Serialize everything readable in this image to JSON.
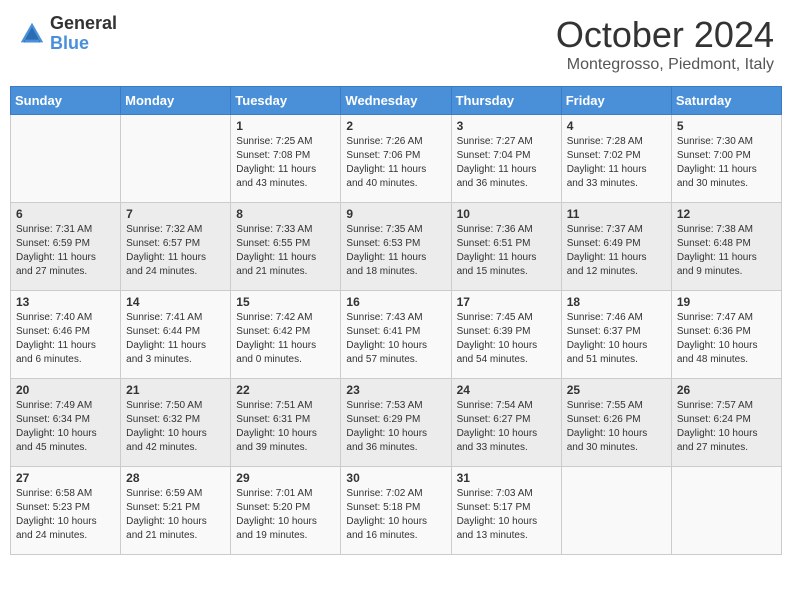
{
  "logo": {
    "general": "General",
    "blue": "Blue"
  },
  "title": "October 2024",
  "location": "Montegrosso, Piedmont, Italy",
  "days_of_week": [
    "Sunday",
    "Monday",
    "Tuesday",
    "Wednesday",
    "Thursday",
    "Friday",
    "Saturday"
  ],
  "weeks": [
    [
      {
        "day": "",
        "info": ""
      },
      {
        "day": "",
        "info": ""
      },
      {
        "day": "1",
        "info": "Sunrise: 7:25 AM\nSunset: 7:08 PM\nDaylight: 11 hours and 43 minutes."
      },
      {
        "day": "2",
        "info": "Sunrise: 7:26 AM\nSunset: 7:06 PM\nDaylight: 11 hours and 40 minutes."
      },
      {
        "day": "3",
        "info": "Sunrise: 7:27 AM\nSunset: 7:04 PM\nDaylight: 11 hours and 36 minutes."
      },
      {
        "day": "4",
        "info": "Sunrise: 7:28 AM\nSunset: 7:02 PM\nDaylight: 11 hours and 33 minutes."
      },
      {
        "day": "5",
        "info": "Sunrise: 7:30 AM\nSunset: 7:00 PM\nDaylight: 11 hours and 30 minutes."
      }
    ],
    [
      {
        "day": "6",
        "info": "Sunrise: 7:31 AM\nSunset: 6:59 PM\nDaylight: 11 hours and 27 minutes."
      },
      {
        "day": "7",
        "info": "Sunrise: 7:32 AM\nSunset: 6:57 PM\nDaylight: 11 hours and 24 minutes."
      },
      {
        "day": "8",
        "info": "Sunrise: 7:33 AM\nSunset: 6:55 PM\nDaylight: 11 hours and 21 minutes."
      },
      {
        "day": "9",
        "info": "Sunrise: 7:35 AM\nSunset: 6:53 PM\nDaylight: 11 hours and 18 minutes."
      },
      {
        "day": "10",
        "info": "Sunrise: 7:36 AM\nSunset: 6:51 PM\nDaylight: 11 hours and 15 minutes."
      },
      {
        "day": "11",
        "info": "Sunrise: 7:37 AM\nSunset: 6:49 PM\nDaylight: 11 hours and 12 minutes."
      },
      {
        "day": "12",
        "info": "Sunrise: 7:38 AM\nSunset: 6:48 PM\nDaylight: 11 hours and 9 minutes."
      }
    ],
    [
      {
        "day": "13",
        "info": "Sunrise: 7:40 AM\nSunset: 6:46 PM\nDaylight: 11 hours and 6 minutes."
      },
      {
        "day": "14",
        "info": "Sunrise: 7:41 AM\nSunset: 6:44 PM\nDaylight: 11 hours and 3 minutes."
      },
      {
        "day": "15",
        "info": "Sunrise: 7:42 AM\nSunset: 6:42 PM\nDaylight: 11 hours and 0 minutes."
      },
      {
        "day": "16",
        "info": "Sunrise: 7:43 AM\nSunset: 6:41 PM\nDaylight: 10 hours and 57 minutes."
      },
      {
        "day": "17",
        "info": "Sunrise: 7:45 AM\nSunset: 6:39 PM\nDaylight: 10 hours and 54 minutes."
      },
      {
        "day": "18",
        "info": "Sunrise: 7:46 AM\nSunset: 6:37 PM\nDaylight: 10 hours and 51 minutes."
      },
      {
        "day": "19",
        "info": "Sunrise: 7:47 AM\nSunset: 6:36 PM\nDaylight: 10 hours and 48 minutes."
      }
    ],
    [
      {
        "day": "20",
        "info": "Sunrise: 7:49 AM\nSunset: 6:34 PM\nDaylight: 10 hours and 45 minutes."
      },
      {
        "day": "21",
        "info": "Sunrise: 7:50 AM\nSunset: 6:32 PM\nDaylight: 10 hours and 42 minutes."
      },
      {
        "day": "22",
        "info": "Sunrise: 7:51 AM\nSunset: 6:31 PM\nDaylight: 10 hours and 39 minutes."
      },
      {
        "day": "23",
        "info": "Sunrise: 7:53 AM\nSunset: 6:29 PM\nDaylight: 10 hours and 36 minutes."
      },
      {
        "day": "24",
        "info": "Sunrise: 7:54 AM\nSunset: 6:27 PM\nDaylight: 10 hours and 33 minutes."
      },
      {
        "day": "25",
        "info": "Sunrise: 7:55 AM\nSunset: 6:26 PM\nDaylight: 10 hours and 30 minutes."
      },
      {
        "day": "26",
        "info": "Sunrise: 7:57 AM\nSunset: 6:24 PM\nDaylight: 10 hours and 27 minutes."
      }
    ],
    [
      {
        "day": "27",
        "info": "Sunrise: 6:58 AM\nSunset: 5:23 PM\nDaylight: 10 hours and 24 minutes."
      },
      {
        "day": "28",
        "info": "Sunrise: 6:59 AM\nSunset: 5:21 PM\nDaylight: 10 hours and 21 minutes."
      },
      {
        "day": "29",
        "info": "Sunrise: 7:01 AM\nSunset: 5:20 PM\nDaylight: 10 hours and 19 minutes."
      },
      {
        "day": "30",
        "info": "Sunrise: 7:02 AM\nSunset: 5:18 PM\nDaylight: 10 hours and 16 minutes."
      },
      {
        "day": "31",
        "info": "Sunrise: 7:03 AM\nSunset: 5:17 PM\nDaylight: 10 hours and 13 minutes."
      },
      {
        "day": "",
        "info": ""
      },
      {
        "day": "",
        "info": ""
      }
    ]
  ]
}
